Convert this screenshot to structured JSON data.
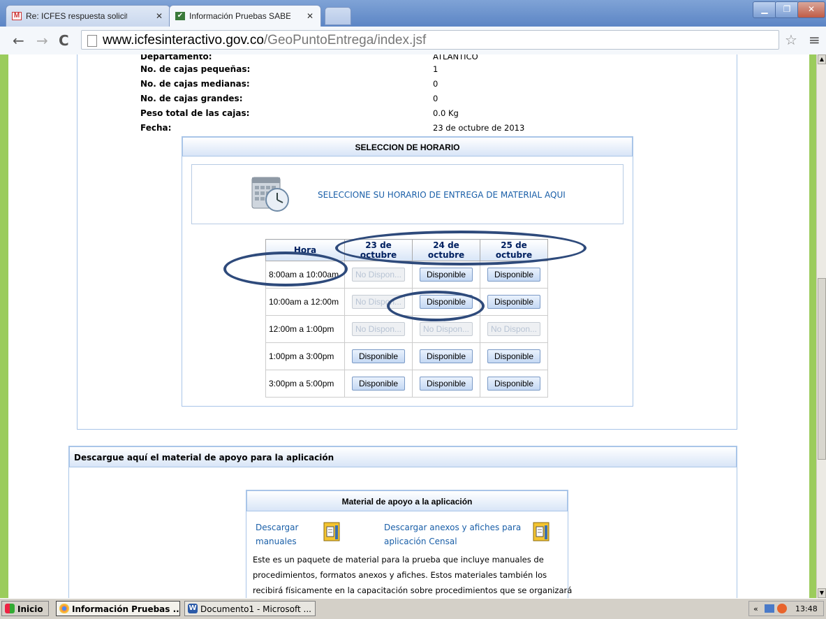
{
  "browser": {
    "tabs": [
      {
        "title": "Re: ICFES respuesta solicitu",
        "active": false
      },
      {
        "title": "Información Pruebas SABER",
        "active": true
      }
    ],
    "url_host": "www.icfesinteractivo.gov.co",
    "url_path": "/GeoPuntoEntrega/index.jsf"
  },
  "info": [
    {
      "label": "Departamento:",
      "value": "ATLANTICO"
    },
    {
      "label": "No. de cajas pequeñas:",
      "value": "1"
    },
    {
      "label": "No. de cajas medianas:",
      "value": "0"
    },
    {
      "label": "No. de cajas grandes:",
      "value": "0"
    },
    {
      "label": "Peso total de las cajas:",
      "value": "0.0 Kg"
    },
    {
      "label": "Fecha:",
      "value": "23 de octubre de 2013"
    }
  ],
  "schedule": {
    "header": "SELECCION DE HORARIO",
    "prompt": "SELECCIONE SU HORARIO DE ENTREGA DE MATERIAL AQUI",
    "columns": [
      "Hora",
      "23 de octubre",
      "24 de octubre",
      "25 de octubre"
    ],
    "rows": [
      {
        "hour": "8:00am a 10:00am",
        "slots": [
          "No Dispon...",
          "Disponible",
          "Disponible"
        ]
      },
      {
        "hour": "10:00am a 12:00m",
        "slots": [
          "No Dispon...",
          "Disponible",
          "Disponible"
        ]
      },
      {
        "hour": "12:00m a 1:00pm",
        "slots": [
          "No Dispon...",
          "No Dispon...",
          "No Dispon..."
        ]
      },
      {
        "hour": "1:00pm a 3:00pm",
        "slots": [
          "Disponible",
          "Disponible",
          "Disponible"
        ]
      },
      {
        "hour": "3:00pm a 5:00pm",
        "slots": [
          "Disponible",
          "Disponible",
          "Disponible"
        ]
      }
    ]
  },
  "material": {
    "section_title": "Descargue aquí el material de apoyo para la aplicación",
    "box_title": "Material de apoyo a la aplicación",
    "link1_line1": "Descargar",
    "link1_line2": "manuales",
    "link2_line1": "Descargar anexos y afiches para",
    "link2_line2": "aplicación Censal",
    "desc_line1": "Este es un paquete de material para la prueba que incluye manuales de",
    "desc_line2": "procedimientos, formatos anexos y afiches. Estos materiales también los",
    "desc_line3": "recibirá físicamente en la capacitación sobre procedimientos que se organizará"
  },
  "taskbar": {
    "start": "Inicio",
    "items": [
      "Información Pruebas ...",
      "Documento1 - Microsoft ..."
    ],
    "tray_chevron": "«",
    "clock": "13:48"
  },
  "colors": {
    "green_border": "#9bcc5c",
    "link_blue": "#1a5fa8",
    "header_navy": "#002060",
    "annotation_oval": "#2e4a7b"
  }
}
